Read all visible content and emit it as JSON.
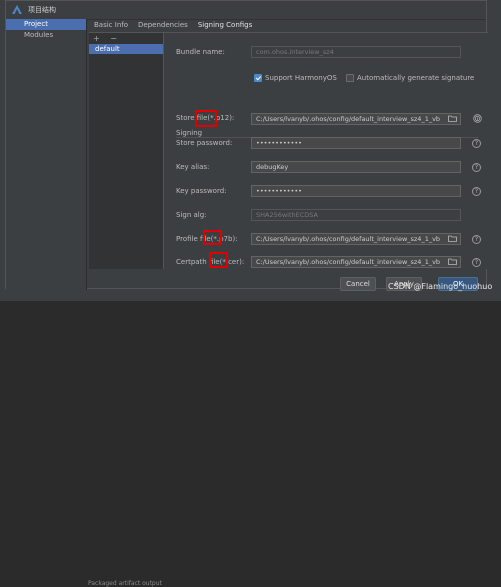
{
  "window": {
    "title": "项目结构"
  },
  "sidebar": {
    "items": [
      {
        "label": "Project"
      },
      {
        "label": "Modules"
      }
    ]
  },
  "tabs": [
    {
      "label": "Basic Info"
    },
    {
      "label": "Dependencies"
    },
    {
      "label": "Signing Configs"
    }
  ],
  "configs": {
    "toolbar": "+ −",
    "items": [
      {
        "label": "default"
      }
    ]
  },
  "form": {
    "bundle_name_label": "Bundle name:",
    "bundle_name_value": "com.ohos.interview_sz4",
    "support_harmonyos_label": "Support HarmonyOS",
    "support_harmonyos_checked": true,
    "auto_generate_label": "Automatically generate signature",
    "auto_generate_checked": false,
    "signing_section": "Signing",
    "store_file_label": "Store file(*.p12):",
    "store_file_value": "C:/Users/lvanyb/.ohos/config/default_interview_sz4_1_vb",
    "store_password_label": "Store password:",
    "store_password_value": "••••••••••••",
    "key_alias_label": "Key alias:",
    "key_alias_value": "debugKey",
    "key_password_label": "Key password:",
    "key_password_value": "••••••••••••",
    "sign_alg_label": "Sign alg:",
    "sign_alg_value": "SHA256withECDSA",
    "profile_file_label": "Profile file(*.p7b):",
    "profile_file_value": "C:/Users/lvanyb/.ohos/config/default_interview_sz4_1_vb",
    "certpath_file_label": "Certpath file(*.cer):",
    "certpath_file_value": "C:/Users/lvanyb/.ohos/config/default_interview_sz4_1_vb",
    "help_glyph": "?"
  },
  "buttons": {
    "cancel": "Cancel",
    "apply": "Apply",
    "ok": "OK"
  },
  "watermark": "CSDN @Flamingo_huohuo",
  "status_strip": "Packaged artifact output",
  "colors": {
    "accent": "#4a88c7",
    "selection": "#4b6eaf",
    "highlight_box": "#e00000"
  }
}
